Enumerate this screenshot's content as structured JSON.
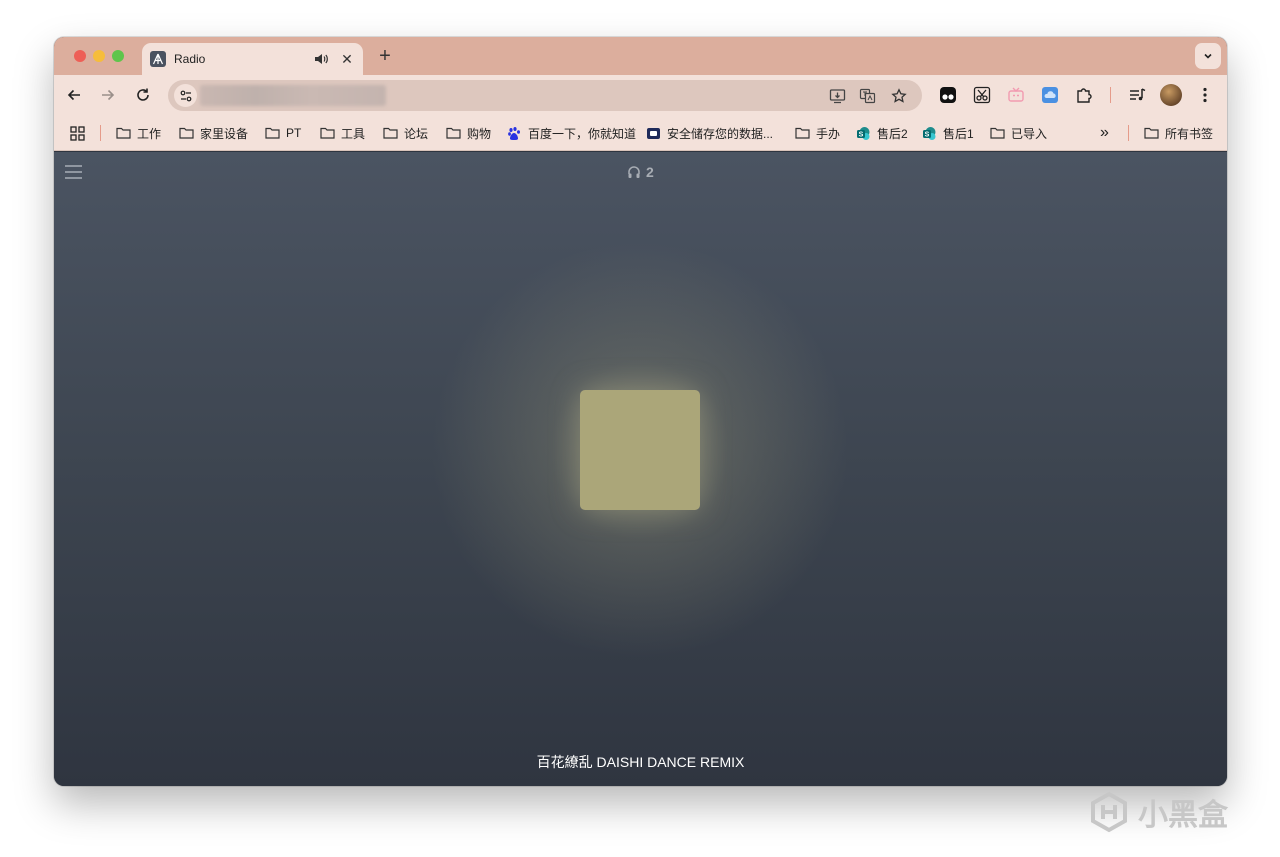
{
  "tab": {
    "title": "Radio",
    "close_glyph": "✕",
    "new_tab_glyph": "+",
    "icons": [
      "radio-favicon",
      "audio-playing-icon"
    ]
  },
  "toolbar": {
    "icons": [
      "back-icon",
      "forward-icon",
      "reload-icon",
      "site-info-icon",
      "install-app-icon",
      "translate-icon",
      "bookmark-star-icon",
      "extension-icons",
      "extensions-puzzle-icon",
      "media-control-icon",
      "profile-avatar",
      "more-menu-icon"
    ]
  },
  "bookmarks": {
    "items": [
      {
        "label": "工作",
        "icon": "folder-icon"
      },
      {
        "label": "家里设备",
        "icon": "folder-icon"
      },
      {
        "label": "PT",
        "icon": "folder-icon"
      },
      {
        "label": "工具",
        "icon": "folder-icon"
      },
      {
        "label": "论坛",
        "icon": "folder-icon"
      },
      {
        "label": "购物",
        "icon": "folder-icon"
      },
      {
        "label": "百度一下，你就知道",
        "icon": "baidu-icon"
      },
      {
        "label": "安全储存您的数据...",
        "icon": "storage-icon"
      },
      {
        "label": "手办",
        "icon": "folder-icon"
      },
      {
        "label": "售后2",
        "icon": "sharepoint-icon"
      },
      {
        "label": "售后1",
        "icon": "sharepoint-icon"
      },
      {
        "label": "已导入",
        "icon": "folder-icon"
      }
    ],
    "overflow_glyph": "»",
    "all_bookmarks": "所有书签"
  },
  "player": {
    "listener_count": "2",
    "song_title": "百花繚乱 DAISHI DANCE REMIX",
    "cover_color": "#aba679"
  },
  "watermark": {
    "text": "小黑盒"
  },
  "colors": {
    "tabstrip": "#dcae9d",
    "toolbar": "#f3e1da",
    "content_top": "#4b5462",
    "content_bottom": "#2f3540"
  }
}
